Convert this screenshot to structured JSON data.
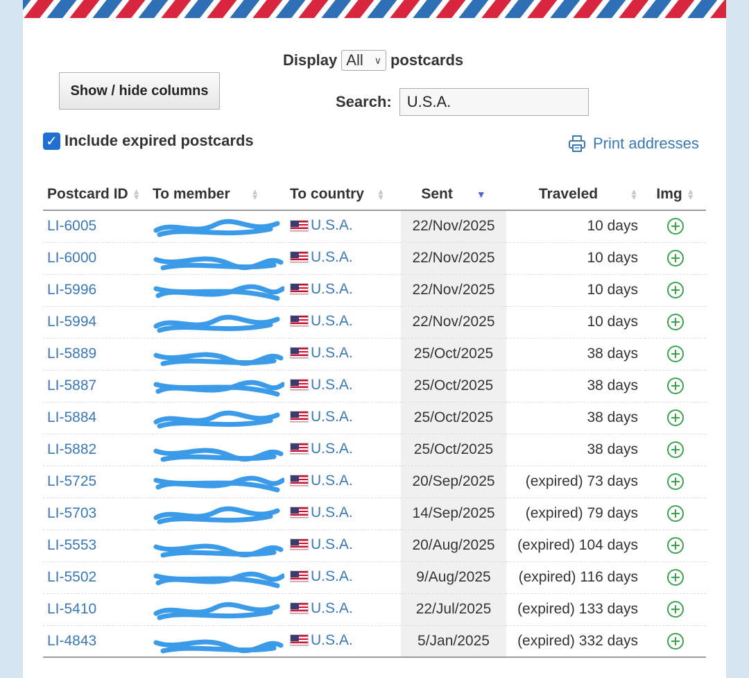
{
  "controls": {
    "display_prefix": "Display",
    "display_value": "All",
    "display_suffix": "postcards",
    "show_hide_label": "Show / hide columns",
    "search_label": "Search:",
    "search_value": "U.S.A.",
    "include_expired_label": "Include expired postcards",
    "include_expired_checked": true,
    "print_label": "Print addresses"
  },
  "table": {
    "headers": [
      "Postcard ID",
      "To member",
      "To country",
      "Sent",
      "Traveled",
      "Img"
    ],
    "sorted_column": "Sent",
    "rows": [
      {
        "id": "LI-6005",
        "country": "U.S.A.",
        "sent": "22/Nov/2025",
        "traveled": "10 days"
      },
      {
        "id": "LI-6000",
        "country": "U.S.A.",
        "sent": "22/Nov/2025",
        "traveled": "10 days"
      },
      {
        "id": "LI-5996",
        "country": "U.S.A.",
        "sent": "22/Nov/2025",
        "traveled": "10 days"
      },
      {
        "id": "LI-5994",
        "country": "U.S.A.",
        "sent": "22/Nov/2025",
        "traveled": "10 days"
      },
      {
        "id": "LI-5889",
        "country": "U.S.A.",
        "sent": "25/Oct/2025",
        "traveled": "38 days"
      },
      {
        "id": "LI-5887",
        "country": "U.S.A.",
        "sent": "25/Oct/2025",
        "traveled": "38 days"
      },
      {
        "id": "LI-5884",
        "country": "U.S.A.",
        "sent": "25/Oct/2025",
        "traveled": "38 days"
      },
      {
        "id": "LI-5882",
        "country": "U.S.A.",
        "sent": "25/Oct/2025",
        "traveled": "38 days"
      },
      {
        "id": "LI-5725",
        "country": "U.S.A.",
        "sent": "20/Sep/2025",
        "traveled": "(expired) 73 days"
      },
      {
        "id": "LI-5703",
        "country": "U.S.A.",
        "sent": "14/Sep/2025",
        "traveled": "(expired) 79 days"
      },
      {
        "id": "LI-5553",
        "country": "U.S.A.",
        "sent": "20/Aug/2025",
        "traveled": "(expired) 104 days"
      },
      {
        "id": "LI-5502",
        "country": "U.S.A.",
        "sent": "9/Aug/2025",
        "traveled": "(expired) 116 days"
      },
      {
        "id": "LI-5410",
        "country": "U.S.A.",
        "sent": "22/Jul/2025",
        "traveled": "(expired) 133 days"
      },
      {
        "id": "LI-4843",
        "country": "U.S.A.",
        "sent": "5/Jan/2025",
        "traveled": "(expired) 332 days"
      }
    ]
  },
  "icons": {
    "row_image": "plus-circle-icon",
    "flag": "us-flag-icon",
    "printer": "printer-icon"
  },
  "colors": {
    "link": "#3a78b5",
    "checkbox": "#1f6fd1",
    "img_icon": "#3aa34a",
    "redaction": "#3b9be8"
  }
}
